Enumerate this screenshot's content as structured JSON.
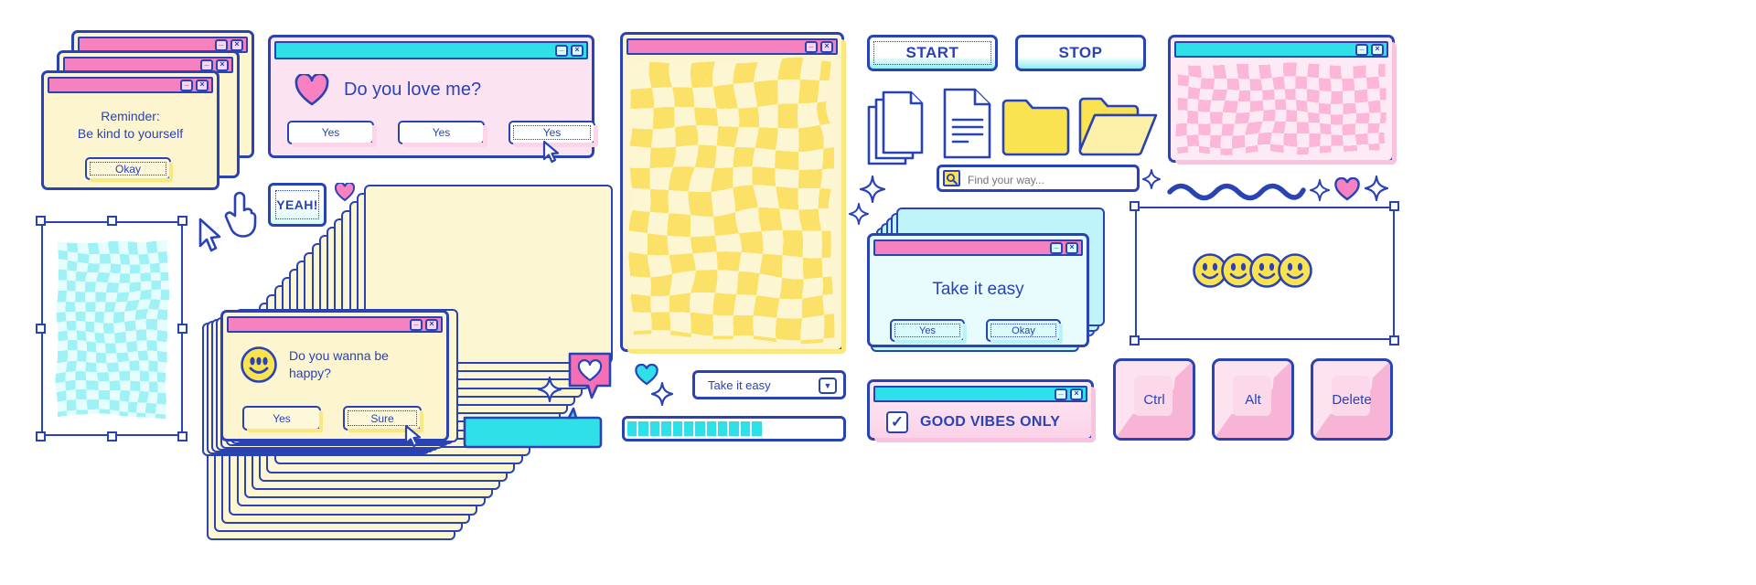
{
  "kit": {
    "title": "Retro Y2K UI Kit",
    "colors": {
      "ink": "#2943b5",
      "pink": "#f681bf",
      "cyan": "#2fe0e8",
      "yellow": "#fbe77f",
      "pink_soft": "#fbd5ea",
      "cyan_pale": "#d9fbfb",
      "yellow_soft": "#fcf5cf"
    }
  },
  "reminder_dialog": {
    "name": "reminder-window",
    "title_bar_color": "#f681bf",
    "line1": "Reminder:",
    "line2": "Be kind to yourself",
    "button_label": "Okay",
    "minimize_glyph": "_",
    "close_glyph": "×",
    "stack_count": 3
  },
  "love_dialog": {
    "name": "do-you-love-me-window",
    "title_bar_color": "#2fe0e8",
    "icon": "heart-icon",
    "message": "Do you love me?",
    "buttons": [
      {
        "label": "Yes",
        "focused": false
      },
      {
        "label": "Yes",
        "focused": false
      },
      {
        "label": "Yes",
        "focused": true
      }
    ],
    "minimize_glyph": "_",
    "close_glyph": "×"
  },
  "yeah_badge": {
    "label": "YEAH!"
  },
  "happy_dialog": {
    "name": "do-you-wanna-be-happy-window",
    "title_bar_color": "#f681bf",
    "icon": "smiley-icon",
    "line1": "Do you wanna be",
    "line2": "happy?",
    "buttons": [
      {
        "label": "Yes",
        "focused": false
      },
      {
        "label": "Sure",
        "focused": true
      }
    ],
    "minimize_glyph": "_",
    "close_glyph": "×"
  },
  "yellow_checker_window": {
    "name": "yellow-checker-window",
    "title_bar_color": "#f681bf",
    "pattern": "warped-checkerboard-yellow",
    "minimize_glyph": "_",
    "close_glyph": "×"
  },
  "pink_checker_window": {
    "name": "pink-checker-window",
    "title_bar_color": "#2fe0e8",
    "pattern": "warped-checkerboard-pink",
    "minimize_glyph": "_",
    "close_glyph": "×"
  },
  "cyan_checker_selection": {
    "name": "cyan-checker-selection",
    "pattern": "warped-checkerboard-cyan",
    "handles": 8
  },
  "start_button": {
    "label": "START"
  },
  "stop_button": {
    "label": "STOP"
  },
  "file_icons": [
    {
      "name": "documents-stack-icon",
      "label": ""
    },
    {
      "name": "text-document-icon",
      "label": ""
    },
    {
      "name": "folder-closed-icon",
      "label": ""
    },
    {
      "name": "folder-open-icon",
      "label": ""
    }
  ],
  "search": {
    "name": "find-your-way-search",
    "placeholder": "Find your way...",
    "value": "",
    "icon": "magnifier-icon"
  },
  "take_it_easy_dialog": {
    "name": "take-it-easy-window",
    "title_bar_color": "#f681bf",
    "message": "Take it easy",
    "buttons": [
      {
        "label": "Yes"
      },
      {
        "label": "Okay"
      }
    ],
    "minimize_glyph": "_",
    "close_glyph": "×",
    "stack_count": 6
  },
  "good_vibes_window": {
    "name": "good-vibes-only-window",
    "title_bar_color": "#2fe0e8",
    "checkbox_checked": true,
    "check_glyph": "✓",
    "label": "GOOD VIBES ONLY",
    "minimize_glyph": "_",
    "close_glyph": "×"
  },
  "dropdown": {
    "name": "take-it-easy-dropdown",
    "value": "Take it easy",
    "chevron": "▼"
  },
  "progress_bar": {
    "name": "loading-progress-bar",
    "segments_total": 19,
    "segments_filled": 12
  },
  "selection_frame": {
    "name": "smiley-selection-frame",
    "handles": 8,
    "content": "four-smiley-faces",
    "smiley_count": 4
  },
  "keys": [
    {
      "label": "Ctrl",
      "name": "key-ctrl"
    },
    {
      "label": "Alt",
      "name": "key-alt"
    },
    {
      "label": "Delete",
      "name": "key-delete"
    }
  ],
  "decorations": {
    "squiggle": "wavy-line",
    "sparkles": 6,
    "hearts": 4,
    "cursor_arrow": "cursor-arrow-icon",
    "cursor_hand": "cursor-pointing-hand-icon",
    "speech_bubble_heart": "heart-speech-bubble",
    "speech_bubble_cyan": "cyan-speech-bubble"
  },
  "window_stacks": {
    "blue_yellow_stack": {
      "name": "window-stack-blue-yellow",
      "count": 22
    },
    "blue_cyan_stack": {
      "name": "window-stack-blue-cyan",
      "count": 14
    }
  }
}
